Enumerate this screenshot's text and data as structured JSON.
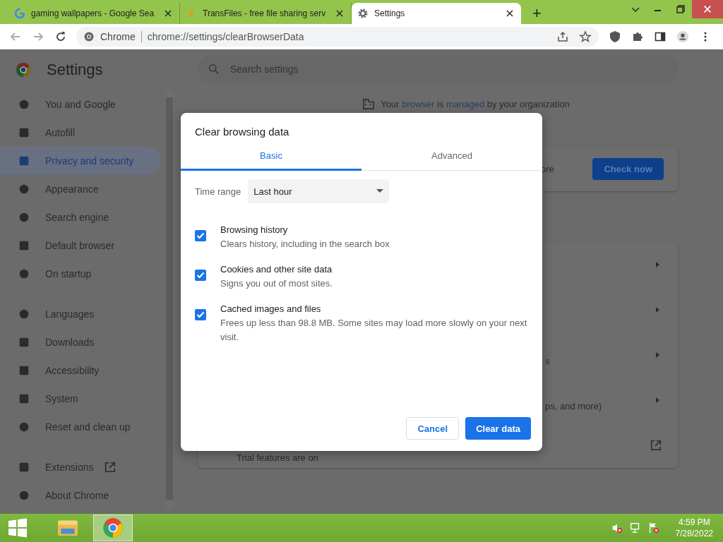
{
  "browser_tabs": [
    {
      "kind": "google",
      "title": "gaming wallpapers - Google Sea",
      "selected": false
    },
    {
      "kind": "arrow",
      "title": "TransFiles - free file sharing serv",
      "selected": false
    },
    {
      "kind": "gear",
      "title": "Settings",
      "selected": true
    }
  ],
  "new_tab": "+",
  "address_bar": {
    "site_label": "Chrome",
    "url": "chrome://settings/clearBrowserData"
  },
  "settings": {
    "title": "Settings",
    "search_placeholder": "Search settings",
    "sidebar_sections": [
      [
        {
          "label": "You and Google",
          "selected": false
        },
        {
          "label": "Autofill",
          "selected": false
        },
        {
          "label": "Privacy and security",
          "selected": true
        },
        {
          "label": "Appearance",
          "selected": false
        },
        {
          "label": "Search engine",
          "selected": false
        },
        {
          "label": "Default browser",
          "selected": false
        },
        {
          "label": "On startup",
          "selected": false
        }
      ],
      [
        {
          "label": "Languages",
          "selected": false
        },
        {
          "label": "Downloads",
          "selected": false
        },
        {
          "label": "Accessibility",
          "selected": false
        },
        {
          "label": "System",
          "selected": false
        },
        {
          "label": "Reset and clean up",
          "selected": false
        }
      ],
      [
        {
          "label": "Extensions",
          "selected": false,
          "external": true
        },
        {
          "label": "About Chrome",
          "selected": false
        }
      ]
    ],
    "managed_notice": {
      "before": "Your",
      "link_1": "browser",
      "middle": "is",
      "link_2": "managed",
      "after": "by your organization"
    },
    "safety_card": {
      "text": "ore",
      "button": "Check now"
    },
    "privacy_rows": [
      {
        "text": ""
      },
      {
        "text": ""
      },
      {
        "text": "s"
      },
      {
        "text": "ps, and more)"
      }
    ],
    "trial_row": {
      "text": "Trial features are on"
    }
  },
  "dialog": {
    "title": "Clear browsing data",
    "tabs": [
      {
        "label": "Basic",
        "selected": true
      },
      {
        "label": "Advanced",
        "selected": false
      }
    ],
    "time_range": {
      "label": "Time range",
      "value": "Last hour"
    },
    "options": [
      {
        "title": "Browsing history",
        "description": "Clears history, including in the search box",
        "checked": true
      },
      {
        "title": "Cookies and other site data",
        "description": "Signs you out of most sites.",
        "checked": true
      },
      {
        "title": "Cached images and files",
        "description": "Frees up less than 98.8 MB. Some sites may load more slowly on your next visit.",
        "checked": true
      }
    ],
    "cancel": "Cancel",
    "confirm": "Clear data"
  },
  "taskbar": {
    "apps": [
      {
        "kind": "explorer",
        "selected": false
      },
      {
        "kind": "chrome",
        "selected": true
      }
    ],
    "time": "4:59 PM",
    "date": "7/28/2022"
  }
}
